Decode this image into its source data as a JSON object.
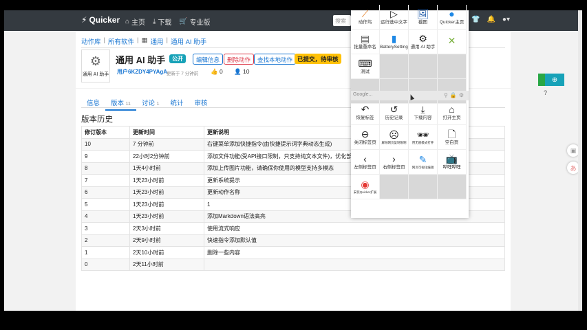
{
  "navbar": {
    "brand": "Quicker",
    "home": "主页",
    "download": "下载",
    "pro": "专业版",
    "search_placeholder": "搜索"
  },
  "breadcrumb": [
    "动作库",
    "所有软件",
    "通用",
    "通用 AI 助手"
  ],
  "action": {
    "icon_label": "通用 AI 助手",
    "title": "通用 AI 助手",
    "public_badge": "公开",
    "edit_button": "编辑信息",
    "delete_button": "删除动作",
    "find_local_button": "查找本地动作",
    "status_badge": "已提交，待审核",
    "author": "用户6KZDY4PYAgA",
    "updated": "更新于 7 分钟前",
    "likes": "0",
    "users": "10"
  },
  "tabs": [
    {
      "label": "信息",
      "count": ""
    },
    {
      "label": "版本",
      "count": "11"
    },
    {
      "label": "讨论",
      "count": "1"
    },
    {
      "label": "统计",
      "count": ""
    },
    {
      "label": "审核",
      "count": ""
    }
  ],
  "history": {
    "title": "版本历史",
    "headers": [
      "修订版本",
      "更新时间",
      "更新说明"
    ],
    "rows": [
      [
        "10",
        "7 分钟前",
        "右键菜单添加快捷指令(由快捷提示词字典动态生成)"
      ],
      [
        "9",
        "22小时2分钟前",
        "添加文件功能(受API接口限制，只支持纯文本文件)，优化部分"
      ],
      [
        "8",
        "1天4小时前",
        "添加上传图片功能，请确保你使用的模型支持多模态"
      ],
      [
        "7",
        "1天23小时前",
        "更新系统提示"
      ],
      [
        "6",
        "1天23小时前",
        "更新动作名称"
      ],
      [
        "5",
        "1天23小时前",
        "1"
      ],
      [
        "4",
        "1天23小时前",
        "添加Markdown语法高亮"
      ],
      [
        "3",
        "2天3小时前",
        "使用流式响应"
      ],
      [
        "2",
        "2天9小时前",
        "快速指令添加默认值"
      ],
      [
        "1",
        "2天10小时前",
        "删除一些内容"
      ],
      [
        "0",
        "2天11小时前",
        ""
      ]
    ]
  },
  "quicker_panel": {
    "top_actions": [
      "动作坞",
      "运行选中文字",
      "截图",
      "Quicker主页",
      "批量重命名",
      "BatterySetting",
      "通用 AI 助手",
      "",
      "测试"
    ],
    "small_label": "安装Quicker扩展",
    "search_placeholder": "Google...",
    "browser_actions": [
      "恢复标签",
      "历史记录",
      "下载内容",
      "打开主页",
      "关闭标签页",
      "解除网页复制限制",
      "用无痕模式打开",
      "空白页",
      "左侧标签页",
      "右侧标签页",
      "网页可视化编辑",
      "哔哩哔哩",
      "安装Quicker扩展"
    ]
  },
  "colors": {
    "navbar": "#343a40",
    "link": "#1976d2",
    "public_badge": "#17a2b8",
    "status_badge": "#ffc107",
    "delete": "#dc3545"
  }
}
